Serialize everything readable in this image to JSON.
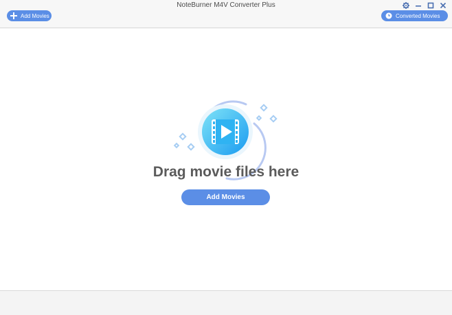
{
  "window": {
    "title": "NoteBurner M4V Converter Plus"
  },
  "toolbar": {
    "add_movies_label": "Add Movies",
    "converted_movies_label": "Converted Movies"
  },
  "main": {
    "drop_title": "Drag movie files here",
    "add_movies_label": "Add Movies"
  },
  "icons": {
    "add": "plus-icon",
    "converted": "clock-icon",
    "settings": "gear-icon",
    "minimize": "minimize-icon",
    "maximize": "maximize-icon",
    "close": "close-icon",
    "video": "video-film-icon"
  },
  "colors": {
    "accent": "#5b8ee6",
    "circle_gradient_start": "#7fe3f7",
    "circle_gradient_end": "#1a9bf0"
  }
}
